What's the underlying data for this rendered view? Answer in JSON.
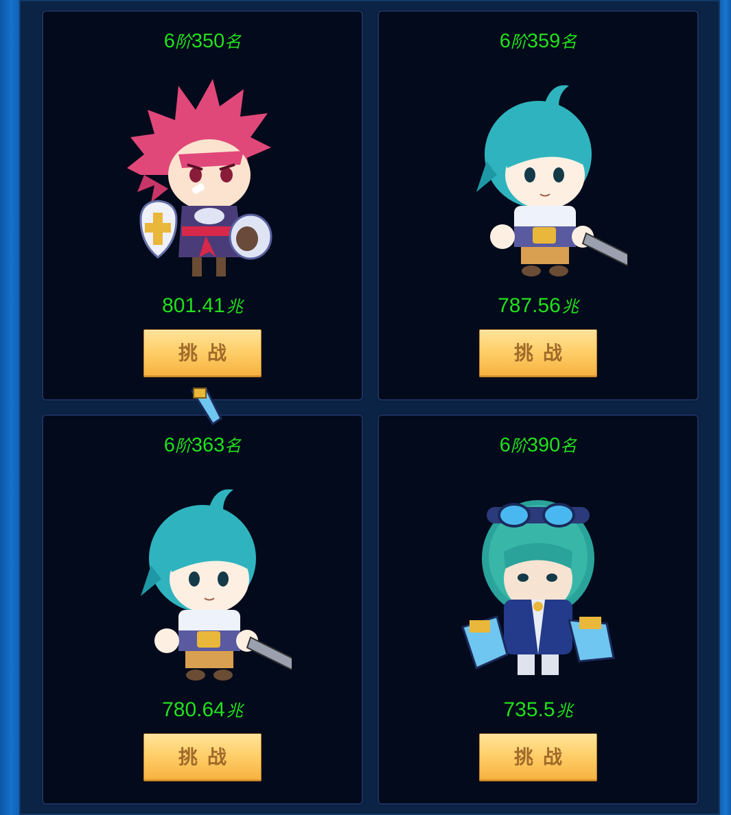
{
  "cards": [
    {
      "tier": "6",
      "tier_unit": "阶",
      "rank": "350",
      "rank_unit": "名",
      "power": "801.41",
      "power_unit": "兆",
      "button_label": "挑战",
      "character": "red-haired-shield-warrior"
    },
    {
      "tier": "6",
      "tier_unit": "阶",
      "rank": "359",
      "rank_unit": "名",
      "power": "787.56",
      "power_unit": "兆",
      "button_label": "挑战",
      "character": "teal-haired-swordsman"
    },
    {
      "tier": "6",
      "tier_unit": "阶",
      "rank": "363",
      "rank_unit": "名",
      "power": "780.64",
      "power_unit": "兆",
      "button_label": "挑战",
      "character": "teal-haired-swordsman"
    },
    {
      "tier": "6",
      "tier_unit": "阶",
      "rank": "390",
      "rank_unit": "名",
      "power": "735.5",
      "power_unit": "兆",
      "button_label": "挑战",
      "character": "goggles-gunner"
    }
  ],
  "colors": {
    "text_green": "#22e01d",
    "card_bg": "#030a1b",
    "button_gold": "#ffcf6a",
    "frame_blue": "#0f63b8"
  }
}
